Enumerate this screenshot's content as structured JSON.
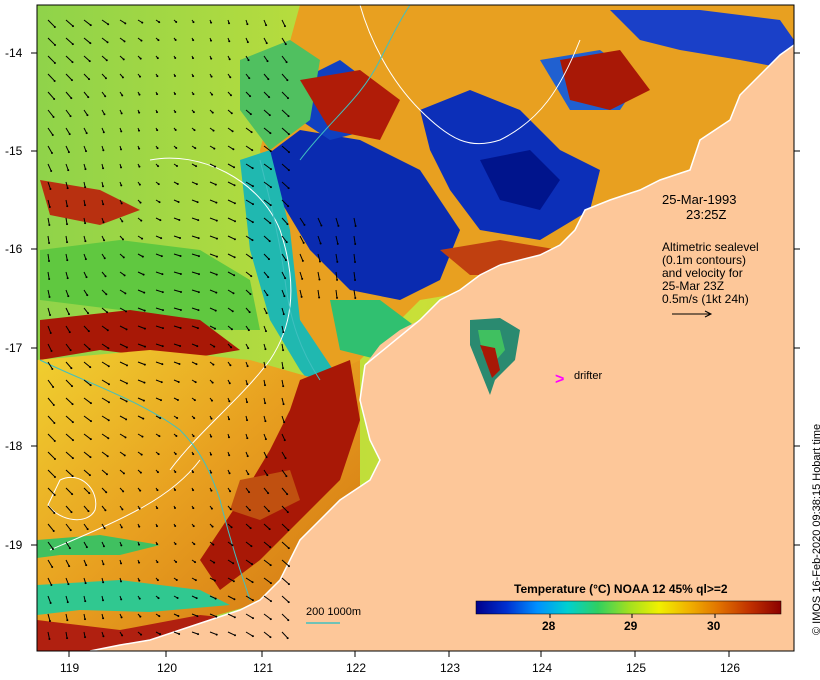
{
  "map": {
    "lon_ticks": [
      "119",
      "120",
      "121",
      "122",
      "123",
      "124",
      "125",
      "126"
    ],
    "lat_ticks": [
      "-14",
      "-15",
      "-16",
      "-17",
      "-18",
      "-19"
    ],
    "land_color": "#fdc799",
    "ocean_warm_color": "#a81806",
    "ocean_cool_color": "#00148c"
  },
  "annotation": {
    "date": "25-Mar-1993",
    "time": "23:25Z",
    "sealevel_lines": [
      "Altimetric sealevel",
      "(0.1m contours)",
      "and velocity for",
      "25-Mar 23Z",
      "0.5m/s (1kt 24h)"
    ],
    "drifter_label": "drifter",
    "drifter_symbol": ">",
    "drifter_color": "#ff00ff"
  },
  "legend": {
    "title": "Temperature (°C) NOAA 12 45% ql>=2",
    "ticks": [
      "28",
      "29",
      "30"
    ],
    "colors": [
      "#00008b",
      "#0030d0",
      "#0090ff",
      "#00d0d0",
      "#30d060",
      "#a0e020",
      "#f0f000",
      "#f0b000",
      "#e07000",
      "#c03000",
      "#8b0000"
    ]
  },
  "bathymetry": {
    "label": "200  1000m",
    "color": "#40c0c0"
  },
  "copyright": "© IMOS 16-Feb-2020 09:38:15 Hobart time"
}
